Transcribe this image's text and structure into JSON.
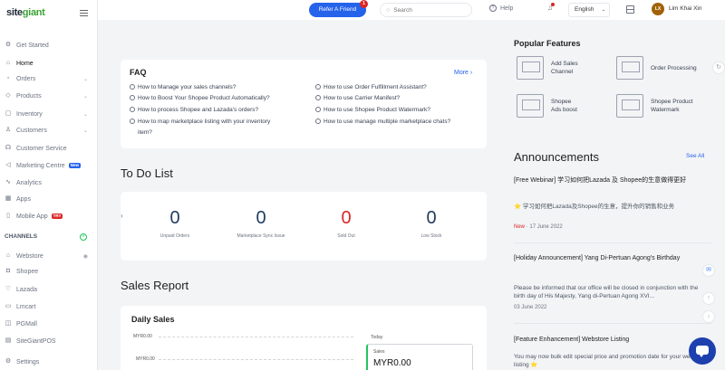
{
  "brand": {
    "logo_a": "site",
    "logo_b": "giant"
  },
  "sidebar": {
    "items": [
      {
        "label": "Get Started",
        "icon": "gear-icon"
      },
      {
        "label": "Home",
        "icon": "home-icon"
      },
      {
        "label": "Orders",
        "icon": "cart-icon"
      },
      {
        "label": "Products",
        "icon": "tag-icon"
      },
      {
        "label": "Inventory",
        "icon": "box-icon"
      },
      {
        "label": "Customers",
        "icon": "users-icon"
      },
      {
        "label": "Customer Service",
        "icon": "headset-icon"
      },
      {
        "label": "Marketing Centre",
        "icon": "megaphone-icon",
        "badge": "New"
      },
      {
        "label": "Analytics",
        "icon": "chart-icon"
      },
      {
        "label": "Apps",
        "icon": "grid-icon"
      },
      {
        "label": "Mobile App",
        "icon": "phone-icon",
        "badge": "TRY"
      }
    ],
    "channels_label": "CHANNELS",
    "channels": [
      {
        "label": "Webstore",
        "icon": "store-icon"
      },
      {
        "label": "Shopee",
        "icon": "shopee-icon"
      },
      {
        "label": "Lazada",
        "icon": "lazada-icon"
      },
      {
        "label": "Lmcart",
        "icon": "cart-icon"
      },
      {
        "label": "PGMall",
        "icon": "mall-icon"
      },
      {
        "label": "SiteGiantPOS",
        "icon": "pos-icon"
      }
    ],
    "settings": "Settings"
  },
  "topbar": {
    "refer_label": "Refer A Friend",
    "refer_badge": "1",
    "search_placeholder": "Search",
    "help_label": "Help",
    "language": "English",
    "avatar_initials": "LX",
    "user_name": "Lim Khai Xin"
  },
  "faq": {
    "title": "FAQ",
    "more": "More",
    "left": [
      "How to Manage your sales channels?",
      "How to Boost Your Shopee Product Automatically?",
      "How to process Shopee and Lazada's orders?",
      "How to map marketplace listing with your inventory",
      "item?"
    ],
    "right": [
      "How to use Order Fulfillment Assistant?",
      "How to use Carrier Manifest?",
      "How to use Shopee Product Watermark?",
      "How to use manage multiple marketplace chats?"
    ]
  },
  "todo": {
    "title": "To Do List",
    "items": [
      {
        "value": "0",
        "label": "Unpaid Orders"
      },
      {
        "value": "0",
        "label": "Marketplace Sync Issue"
      },
      {
        "value": "0",
        "label": "Sold Out"
      },
      {
        "value": "0",
        "label": "Low Stock"
      }
    ]
  },
  "sales": {
    "title": "Sales Report",
    "daily": "Daily Sales",
    "axis_top": "MYR0.00",
    "axis_mid": "MYR0.00",
    "today": "Today",
    "box_label": "Sales",
    "box_value": "MYR0.00"
  },
  "popular": {
    "title": "Popular Features",
    "items": [
      {
        "label1": "Add Sales",
        "label2": "Channel"
      },
      {
        "label1": "Order Processing",
        "label2": ""
      },
      {
        "label1": "Shopee",
        "label2": "Ads boost"
      },
      {
        "label1": "Shopee Product",
        "label2": "Watermark"
      }
    ]
  },
  "announcements": {
    "title": "Announcements",
    "see_all": "See All",
    "items": [
      {
        "heading": "[Free Webinar] 学习如何把Lazada 及 Shopee的生意做得更好",
        "body": "⭐ 学习如何把Lazada及Shopee的生意，提升你的销售和业务",
        "new": "New",
        "date": "17 June 2022"
      },
      {
        "heading": "[Holiday Announcement] Yang Di-Pertuan Agong's Birthday",
        "body": "Please be informed that our office will be closed in conjunction with the birth day of His Majesty, Yang di-Pertuan Agong XVI...",
        "date": "03 June 2022"
      },
      {
        "heading": "[Feature Enhancement] Webstore Listing",
        "body": "You may now bulk edit special price and promotion date for your webstore listing ⭐"
      }
    ]
  }
}
